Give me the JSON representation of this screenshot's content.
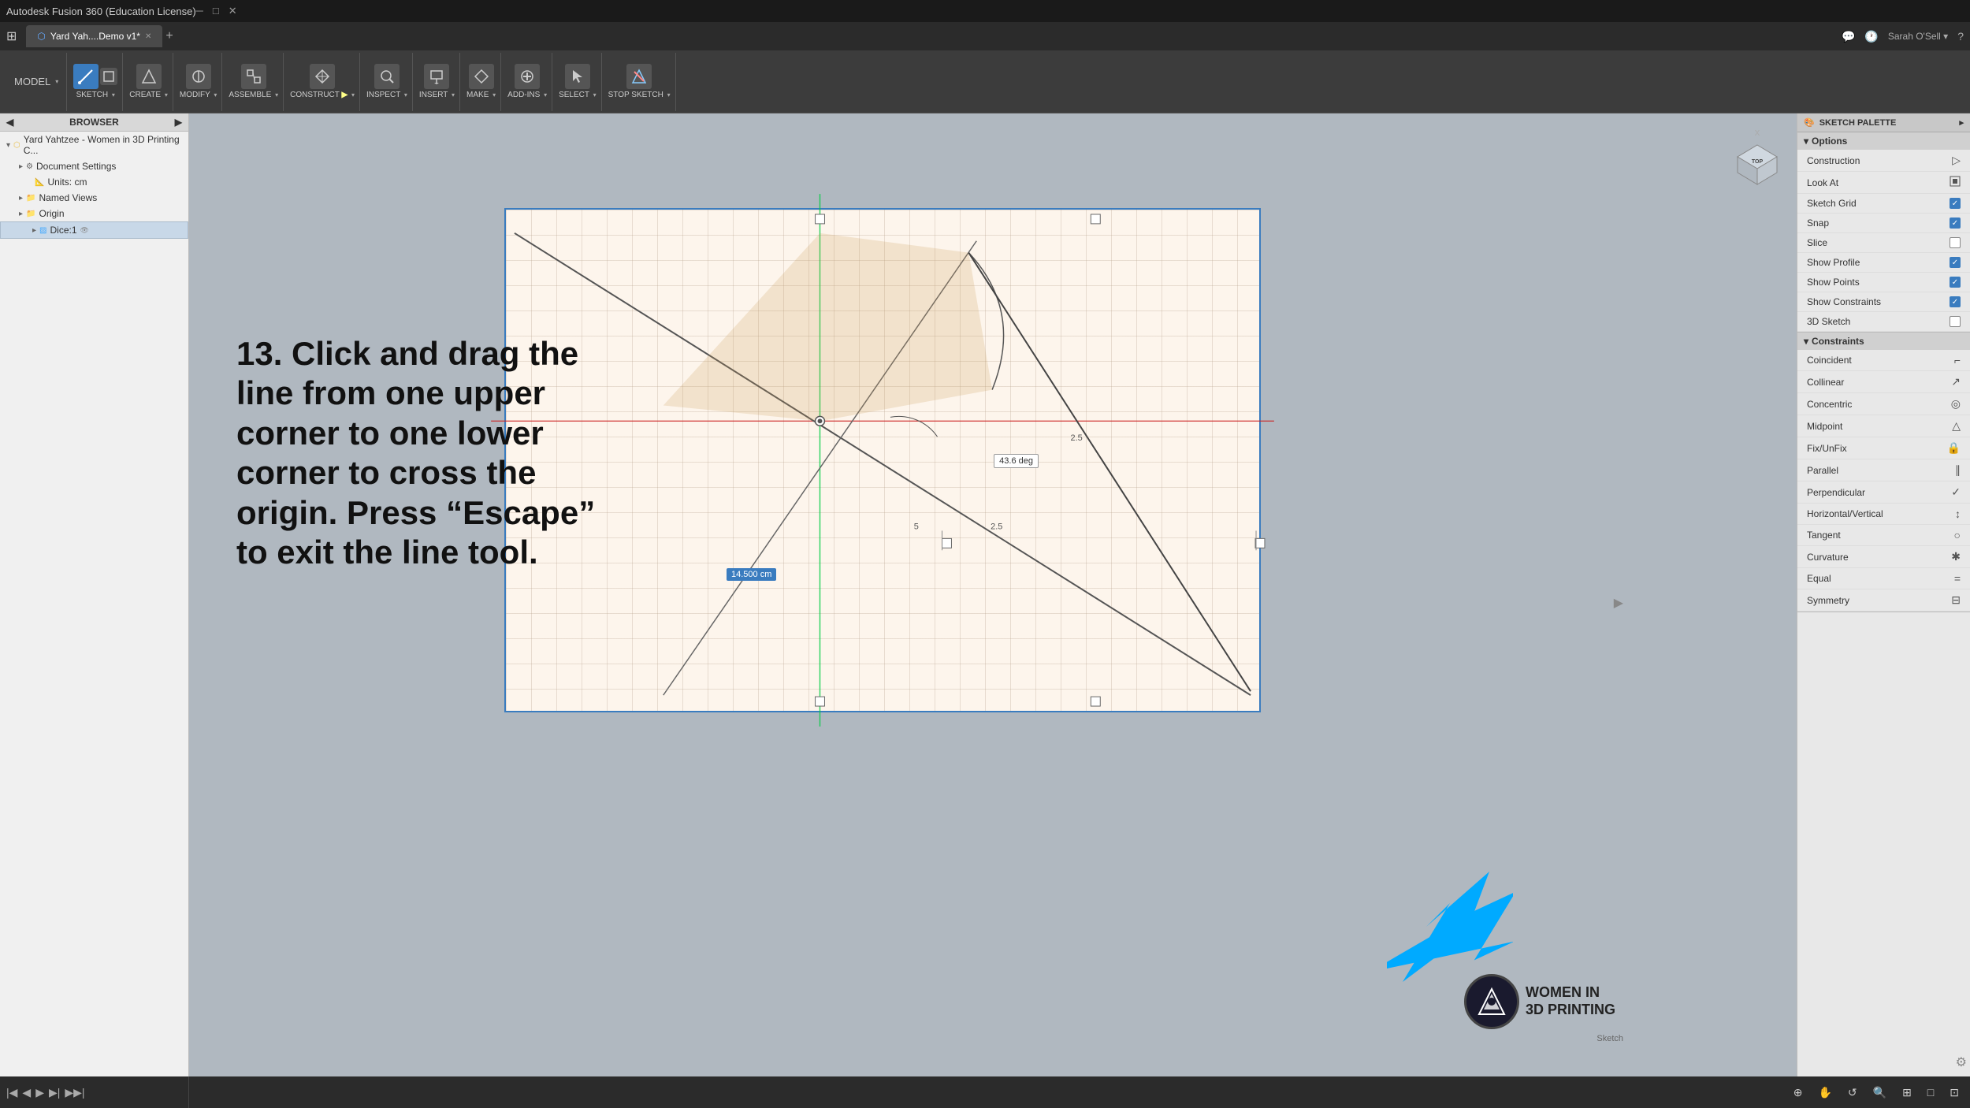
{
  "app": {
    "title": "Autodesk Fusion 360 (Education License)",
    "tab_name": "Yard Yah....Demo v1*",
    "sketch_label": "Sketch"
  },
  "toolbar": {
    "model_label": "MODEL",
    "groups": [
      {
        "label": "SKETCH",
        "has_dropdown": true
      },
      {
        "label": "CREATE",
        "has_dropdown": true
      },
      {
        "label": "MODIFY",
        "has_dropdown": true
      },
      {
        "label": "ASSEMBLE",
        "has_dropdown": true
      },
      {
        "label": "CONSTRUCT",
        "has_dropdown": true
      },
      {
        "label": "INSPECT",
        "has_dropdown": true
      },
      {
        "label": "INSERT",
        "has_dropdown": true
      },
      {
        "label": "MAKE",
        "has_dropdown": true
      },
      {
        "label": "ADD-INS",
        "has_dropdown": true
      },
      {
        "label": "SELECT",
        "has_dropdown": true
      },
      {
        "label": "STOP SKETCH",
        "has_dropdown": true
      }
    ]
  },
  "browser": {
    "title": "BROWSER",
    "items": [
      {
        "label": "Yard Yahtzee - Women in 3D Printing C...",
        "indent": 0,
        "type": "doc"
      },
      {
        "label": "Document Settings",
        "indent": 1,
        "type": "settings"
      },
      {
        "label": "Units: cm",
        "indent": 2,
        "type": "units"
      },
      {
        "label": "Named Views",
        "indent": 1,
        "type": "folder"
      },
      {
        "label": "Origin",
        "indent": 1,
        "type": "folder"
      },
      {
        "label": "Dice:1",
        "indent": 2,
        "type": "layer",
        "active": true
      }
    ]
  },
  "instruction": {
    "text": "13. Click and drag the line from one upper corner to one lower corner to cross the origin. Press “Escape” to exit the line tool."
  },
  "sketch_palette": {
    "title": "SKETCH PALETTE",
    "options_section": "Options",
    "rows": [
      {
        "label": "Construction",
        "icon": "triangle-right",
        "type": "icon"
      },
      {
        "label": "Look At",
        "icon": "cube",
        "type": "icon"
      },
      {
        "label": "Sketch Grid",
        "checked": true,
        "type": "checkbox"
      },
      {
        "label": "Snap",
        "checked": true,
        "type": "checkbox"
      },
      {
        "label": "Slice",
        "checked": false,
        "type": "checkbox"
      },
      {
        "label": "Show Profile",
        "checked": true,
        "type": "checkbox"
      },
      {
        "label": "Show Points",
        "checked": true,
        "type": "checkbox"
      },
      {
        "label": "Show Constraints",
        "checked": true,
        "type": "checkbox"
      },
      {
        "label": "3D Sketch",
        "checked": false,
        "type": "checkbox"
      }
    ],
    "constraints_section": "Constraints",
    "constraints": [
      {
        "label": "Coincident",
        "icon": "L"
      },
      {
        "label": "Collinear",
        "icon": "\\"
      },
      {
        "label": "Concentric",
        "icon": "◎"
      },
      {
        "label": "Midpoint",
        "icon": "△"
      },
      {
        "label": "Fix/UnFix",
        "icon": "🔒"
      },
      {
        "label": "Parallel",
        "icon": "="
      },
      {
        "label": "Perpendicular",
        "icon": "✓"
      },
      {
        "label": "Horizontal/Vertical",
        "icon": "↕"
      },
      {
        "label": "Tangent",
        "icon": "○"
      },
      {
        "label": "Curvature",
        "icon": "✱"
      },
      {
        "label": "Equal",
        "icon": "="
      },
      {
        "label": "Symmetry",
        "icon": "⊟"
      }
    ]
  },
  "canvas": {
    "dim_label": "14.500 cm",
    "angle_label": "43.6 deg"
  },
  "view_cube": {
    "top_label": "TOP"
  },
  "bottom_bar": {
    "sketch_text": "Sketch"
  },
  "watermark": {
    "line1": "WOMEN IN",
    "line2": "3D PRINTING"
  }
}
